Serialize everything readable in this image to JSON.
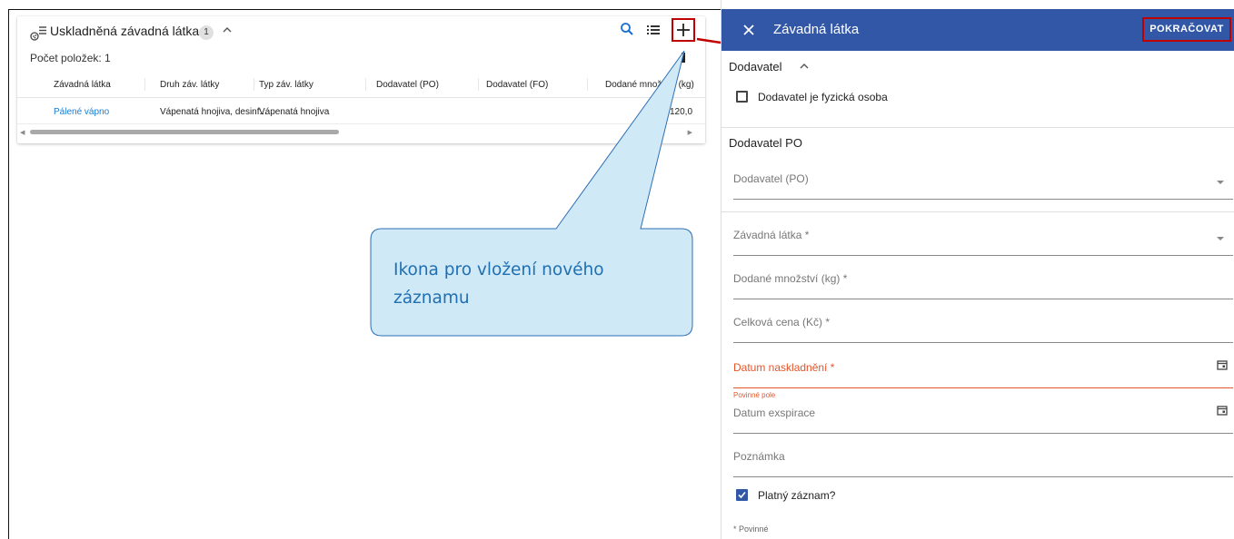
{
  "left": {
    "card": {
      "title": "Uskladněná závadná látka",
      "count": "1",
      "item_count": "Počet položek: 1",
      "icons": [
        "storage-icon",
        "chevron-up-icon",
        "search-icon",
        "list-icon",
        "plus-icon"
      ],
      "columns": [
        "Závadná látka",
        "Druh záv. látky",
        "Typ záv. látky",
        "Dodavatel (PO)",
        "Dodavatel (FO)",
        "Dodané množství (kg)"
      ],
      "rows": [
        {
          "substance": "Pálené vápno",
          "kind": "Vápenatá hnojiva, desinf...",
          "type": "Vápenatá hnojiva",
          "supplier_po": "",
          "supplier_fo": "",
          "amount": "120,0"
        }
      ]
    },
    "callout": {
      "text": "Ikona pro vložení nového záznamu"
    }
  },
  "panel": {
    "title": "Závadná látka",
    "continue_label": "POKRAČOVAT",
    "section_supplier": "Dodavatel",
    "supplier_is_person_label": "Dodavatel je fyzická osoba",
    "supplier_is_person_checked": false,
    "section_po": "Dodavatel PO",
    "fields": {
      "supplier_po": "Dodavatel (PO)",
      "substance": "Závadná látka *",
      "amount": "Dodané množství (kg) *",
      "price": "Celková cena (Kč) *",
      "stock_date": "Datum naskladnění *",
      "stock_date_error": "Povinné pole",
      "expiry_date": "Datum exspirace",
      "note": "Poznámka"
    },
    "valid_record_label": "Platný záznam?",
    "valid_record_checked": true,
    "required_note": "* Povinné"
  },
  "colors": {
    "header_blue": "#3257a6",
    "highlight_red": "#c00000",
    "error_orange": "#e5542a",
    "link_blue": "#1a7cd1",
    "callout_fill": "#cfe9f7",
    "callout_text": "#1f6fb2"
  }
}
